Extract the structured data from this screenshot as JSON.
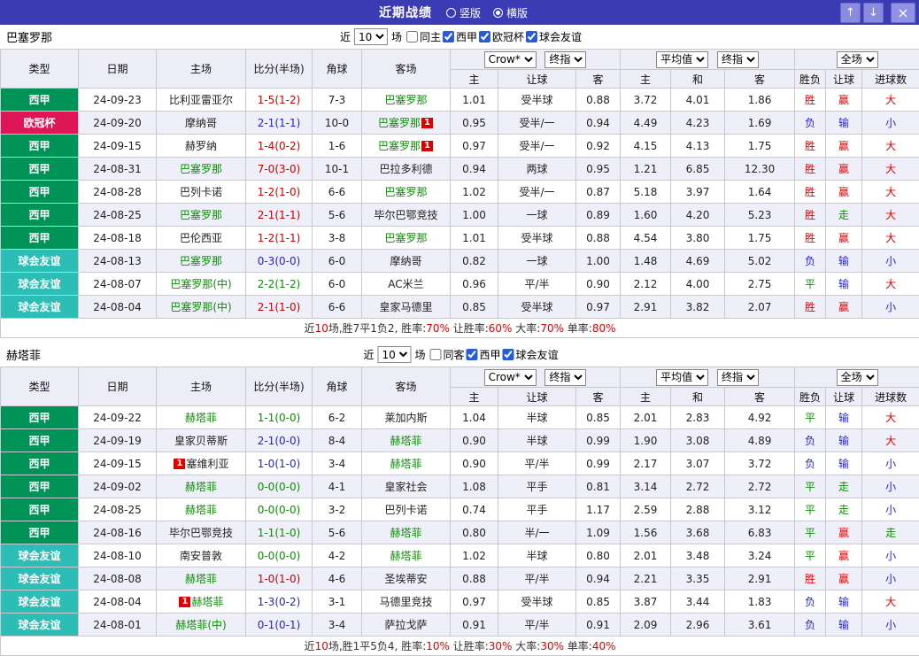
{
  "topbar": {
    "title": "近期战绩",
    "view_options": [
      {
        "label": "竖版",
        "selected": false
      },
      {
        "label": "横版",
        "selected": true
      }
    ],
    "up_icon": "↑",
    "down_icon": "↓",
    "close_icon": "×"
  },
  "colors": {
    "topbar_bg": "#3B3BB3",
    "liga_badge_green": "#009357",
    "ucl_badge_red": "#DE1556",
    "friendly_badge_teal": "#2CBDB5",
    "win_red": "#E60000",
    "loss_blue": "#2424D0",
    "draw_green": "#089000",
    "focal_team_green": "#089000"
  },
  "sections": [
    {
      "team": "巴塞罗那",
      "filter": {
        "near_label": "近",
        "count": "10",
        "games_label": "场",
        "checkboxes": [
          {
            "label": "同主",
            "checked": false
          },
          {
            "label": "西甲",
            "checked": true
          },
          {
            "label": "欧冠杯",
            "checked": true
          },
          {
            "label": "球会友谊",
            "checked": true
          }
        ]
      },
      "dropdowns": {
        "company": "Crow*",
        "company_time": "终指",
        "avg": "平均值",
        "avg_time": "终指",
        "scope": "全场"
      },
      "columns": [
        "类型",
        "日期",
        "主场",
        "比分(半场)",
        "角球",
        "客场",
        "主",
        "让球",
        "客",
        "主",
        "和",
        "客",
        "胜负",
        "让球",
        "进球数"
      ],
      "rows": [
        {
          "league": "西甲",
          "league_color": "green",
          "date": "24-09-23",
          "home": {
            "text": "比利亚雷亚尔"
          },
          "score": "1-5(1-2)",
          "corner": "7-3",
          "away": {
            "text": "巴塞罗那",
            "focal": true
          },
          "odds": [
            "1.01",
            "受半球",
            "0.88"
          ],
          "avg": [
            "3.72",
            "4.01",
            "1.86"
          ],
          "result": "胜",
          "handicap_result": "赢",
          "goals": "大"
        },
        {
          "league": "欧冠杯",
          "league_color": "red",
          "date": "24-09-20",
          "home": {
            "text": "摩纳哥"
          },
          "score": "2-1(1-1)",
          "corner": "10-0",
          "away": {
            "text": "巴塞罗那",
            "focal": true,
            "badge_after": "1"
          },
          "odds": [
            "0.95",
            "受半/一",
            "0.94"
          ],
          "avg": [
            "4.49",
            "4.23",
            "1.69"
          ],
          "result": "负",
          "handicap_result": "输",
          "goals": "小"
        },
        {
          "league": "西甲",
          "league_color": "green",
          "date": "24-09-15",
          "home": {
            "text": "赫罗纳"
          },
          "score": "1-4(0-2)",
          "corner": "1-6",
          "away": {
            "text": "巴塞罗那",
            "focal": true,
            "badge_after": "1"
          },
          "odds": [
            "0.97",
            "受半/一",
            "0.92"
          ],
          "avg": [
            "4.15",
            "4.13",
            "1.75"
          ],
          "result": "胜",
          "handicap_result": "赢",
          "goals": "大"
        },
        {
          "league": "西甲",
          "league_color": "green",
          "date": "24-08-31",
          "home": {
            "text": "巴塞罗那",
            "focal": true
          },
          "score": "7-0(3-0)",
          "corner": "10-1",
          "away": {
            "text": "巴拉多利德"
          },
          "odds": [
            "0.94",
            "两球",
            "0.95"
          ],
          "avg": [
            "1.21",
            "6.85",
            "12.30"
          ],
          "result": "胜",
          "handicap_result": "赢",
          "goals": "大"
        },
        {
          "league": "西甲",
          "league_color": "green",
          "date": "24-08-28",
          "home": {
            "text": "巴列卡诺"
          },
          "score": "1-2(1-0)",
          "corner": "6-6",
          "away": {
            "text": "巴塞罗那",
            "focal": true
          },
          "odds": [
            "1.02",
            "受半/一",
            "0.87"
          ],
          "avg": [
            "5.18",
            "3.97",
            "1.64"
          ],
          "result": "胜",
          "handicap_result": "赢",
          "goals": "大"
        },
        {
          "league": "西甲",
          "league_color": "green",
          "date": "24-08-25",
          "home": {
            "text": "巴塞罗那",
            "focal": true
          },
          "score": "2-1(1-1)",
          "corner": "5-6",
          "away": {
            "text": "毕尔巴鄂竞技"
          },
          "odds": [
            "1.00",
            "一球",
            "0.89"
          ],
          "avg": [
            "1.60",
            "4.20",
            "5.23"
          ],
          "result": "胜",
          "handicap_result": "走",
          "goals": "大"
        },
        {
          "league": "西甲",
          "league_color": "green",
          "date": "24-08-18",
          "home": {
            "text": "巴伦西亚"
          },
          "score": "1-2(1-1)",
          "corner": "3-8",
          "away": {
            "text": "巴塞罗那",
            "focal": true
          },
          "odds": [
            "1.01",
            "受半球",
            "0.88"
          ],
          "avg": [
            "4.54",
            "3.80",
            "1.75"
          ],
          "result": "胜",
          "handicap_result": "赢",
          "goals": "大"
        },
        {
          "league": "球会友谊",
          "league_color": "teal",
          "date": "24-08-13",
          "home": {
            "text": "巴塞罗那",
            "focal": true
          },
          "score": "0-3(0-0)",
          "corner": "6-0",
          "away": {
            "text": "摩纳哥"
          },
          "odds": [
            "0.82",
            "一球",
            "1.00"
          ],
          "avg": [
            "1.48",
            "4.69",
            "5.02"
          ],
          "result": "负",
          "handicap_result": "输",
          "goals": "小"
        },
        {
          "league": "球会友谊",
          "league_color": "teal",
          "date": "24-08-07",
          "home": {
            "text": "巴塞罗那(中)",
            "focal": true
          },
          "score": "2-2(1-2)",
          "corner": "6-0",
          "away": {
            "text": "AC米兰"
          },
          "odds": [
            "0.96",
            "平/半",
            "0.90"
          ],
          "avg": [
            "2.12",
            "4.00",
            "2.75"
          ],
          "result": "平",
          "handicap_result": "输",
          "goals": "大"
        },
        {
          "league": "球会友谊",
          "league_color": "teal",
          "date": "24-08-04",
          "home": {
            "text": "巴塞罗那(中)",
            "focal": true
          },
          "score": "2-1(1-0)",
          "corner": "6-6",
          "away": {
            "text": "皇家马德里"
          },
          "odds": [
            "0.85",
            "受半球",
            "0.97"
          ],
          "avg": [
            "2.91",
            "3.82",
            "2.07"
          ],
          "result": "胜",
          "handicap_result": "赢",
          "goals": "小"
        }
      ],
      "summary": [
        {
          "t": "近"
        },
        {
          "t": "10",
          "c": "red"
        },
        {
          "t": "场,胜7平1负2, 胜率:"
        },
        {
          "t": "70%",
          "c": "red"
        },
        {
          "t": " 让胜率:"
        },
        {
          "t": "60%",
          "c": "red"
        },
        {
          "t": " 大率:"
        },
        {
          "t": "70%",
          "c": "red"
        },
        {
          "t": " 单率:"
        },
        {
          "t": "80%",
          "c": "red"
        }
      ]
    },
    {
      "team": "赫塔菲",
      "filter": {
        "near_label": "近",
        "count": "10",
        "games_label": "场",
        "checkboxes": [
          {
            "label": "同客",
            "checked": false
          },
          {
            "label": "西甲",
            "checked": true
          },
          {
            "label": "球会友谊",
            "checked": true
          }
        ]
      },
      "dropdowns": {
        "company": "Crow*",
        "company_time": "终指",
        "avg": "平均值",
        "avg_time": "终指",
        "scope": "全场"
      },
      "columns": [
        "类型",
        "日期",
        "主场",
        "比分(半场)",
        "角球",
        "客场",
        "主",
        "让球",
        "客",
        "主",
        "和",
        "客",
        "胜负",
        "让球",
        "进球数"
      ],
      "rows": [
        {
          "league": "西甲",
          "league_color": "green",
          "date": "24-09-22",
          "home": {
            "text": "赫塔菲",
            "focal": true
          },
          "score": "1-1(0-0)",
          "corner": "6-2",
          "away": {
            "text": "莱加内斯"
          },
          "odds": [
            "1.04",
            "半球",
            "0.85"
          ],
          "avg": [
            "2.01",
            "2.83",
            "4.92"
          ],
          "result": "平",
          "handicap_result": "输",
          "goals": "大"
        },
        {
          "league": "西甲",
          "league_color": "green",
          "date": "24-09-19",
          "home": {
            "text": "皇家贝蒂斯"
          },
          "score": "2-1(0-0)",
          "corner": "8-4",
          "away": {
            "text": "赫塔菲",
            "focal": true
          },
          "odds": [
            "0.90",
            "半球",
            "0.99"
          ],
          "avg": [
            "1.90",
            "3.08",
            "4.89"
          ],
          "result": "负",
          "handicap_result": "输",
          "goals": "大"
        },
        {
          "league": "西甲",
          "league_color": "green",
          "date": "24-09-15",
          "home": {
            "text": "塞维利亚",
            "badge_before": "1"
          },
          "score": "1-0(1-0)",
          "corner": "3-4",
          "away": {
            "text": "赫塔菲",
            "focal": true
          },
          "odds": [
            "0.90",
            "平/半",
            "0.99"
          ],
          "avg": [
            "2.17",
            "3.07",
            "3.72"
          ],
          "result": "负",
          "handicap_result": "输",
          "goals": "小"
        },
        {
          "league": "西甲",
          "league_color": "green",
          "date": "24-09-02",
          "home": {
            "text": "赫塔菲",
            "focal": true
          },
          "score": "0-0(0-0)",
          "corner": "4-1",
          "away": {
            "text": "皇家社会"
          },
          "odds": [
            "1.08",
            "平手",
            "0.81"
          ],
          "avg": [
            "3.14",
            "2.72",
            "2.72"
          ],
          "result": "平",
          "handicap_result": "走",
          "goals": "小"
        },
        {
          "league": "西甲",
          "league_color": "green",
          "date": "24-08-25",
          "home": {
            "text": "赫塔菲",
            "focal": true
          },
          "score": "0-0(0-0)",
          "corner": "3-2",
          "away": {
            "text": "巴列卡诺"
          },
          "odds": [
            "0.74",
            "平手",
            "1.17"
          ],
          "avg": [
            "2.59",
            "2.88",
            "3.12"
          ],
          "result": "平",
          "handicap_result": "走",
          "goals": "小"
        },
        {
          "league": "西甲",
          "league_color": "green",
          "date": "24-08-16",
          "home": {
            "text": "毕尔巴鄂竞技"
          },
          "score": "1-1(1-0)",
          "corner": "5-6",
          "away": {
            "text": "赫塔菲",
            "focal": true
          },
          "odds": [
            "0.80",
            "半/一",
            "1.09"
          ],
          "avg": [
            "1.56",
            "3.68",
            "6.83"
          ],
          "result": "平",
          "handicap_result": "赢",
          "goals": "走"
        },
        {
          "league": "球会友谊",
          "league_color": "teal",
          "date": "24-08-10",
          "home": {
            "text": "南安普敦"
          },
          "score": "0-0(0-0)",
          "corner": "4-2",
          "away": {
            "text": "赫塔菲",
            "focal": true
          },
          "odds": [
            "1.02",
            "半球",
            "0.80"
          ],
          "avg": [
            "2.01",
            "3.48",
            "3.24"
          ],
          "result": "平",
          "handicap_result": "赢",
          "goals": "小"
        },
        {
          "league": "球会友谊",
          "league_color": "teal",
          "date": "24-08-08",
          "home": {
            "text": "赫塔菲",
            "focal": true
          },
          "score": "1-0(1-0)",
          "corner": "4-6",
          "away": {
            "text": "圣埃蒂安"
          },
          "odds": [
            "0.88",
            "平/半",
            "0.94"
          ],
          "avg": [
            "2.21",
            "3.35",
            "2.91"
          ],
          "result": "胜",
          "handicap_result": "赢",
          "goals": "小"
        },
        {
          "league": "球会友谊",
          "league_color": "teal",
          "date": "24-08-04",
          "home": {
            "text": "赫塔菲",
            "focal": true,
            "badge_before": "1"
          },
          "score": "1-3(0-2)",
          "corner": "3-1",
          "away": {
            "text": "马德里竞技"
          },
          "odds": [
            "0.97",
            "受半球",
            "0.85"
          ],
          "avg": [
            "3.87",
            "3.44",
            "1.83"
          ],
          "result": "负",
          "handicap_result": "输",
          "goals": "大"
        },
        {
          "league": "球会友谊",
          "league_color": "teal",
          "date": "24-08-01",
          "home": {
            "text": "赫塔菲(中)",
            "focal": true
          },
          "score": "0-1(0-1)",
          "corner": "3-4",
          "away": {
            "text": "萨拉戈萨"
          },
          "odds": [
            "0.91",
            "平/半",
            "0.91"
          ],
          "avg": [
            "2.09",
            "2.96",
            "3.61"
          ],
          "result": "负",
          "handicap_result": "输",
          "goals": "小"
        }
      ],
      "summary": [
        {
          "t": "近"
        },
        {
          "t": "10",
          "c": "red"
        },
        {
          "t": "场,胜1平5负4, 胜率:"
        },
        {
          "t": "10%",
          "c": "red"
        },
        {
          "t": " 让胜率:"
        },
        {
          "t": "30%",
          "c": "red"
        },
        {
          "t": " 大率:"
        },
        {
          "t": "30%",
          "c": "red"
        },
        {
          "t": " 单率:"
        },
        {
          "t": "40%",
          "c": "red"
        }
      ]
    }
  ]
}
